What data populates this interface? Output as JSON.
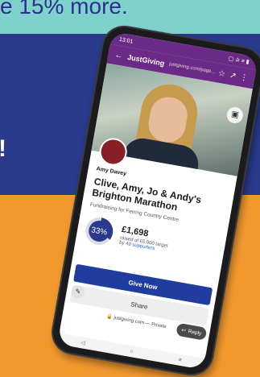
{
  "background": {
    "headline": "e 15% more.",
    "exclamation": "!"
  },
  "status_bar": {
    "time": "13:01",
    "icons": "▢ ✰ ≡ ▮"
  },
  "app_bar": {
    "brand": "JustGiving",
    "url": "justgiving.com/page..."
  },
  "page": {
    "owner_name": "Amy Davey",
    "title": "Clive, Amy, Jo & Andy's Brighton Marathon",
    "fundraising_for": "Fundraising for Ferring Country Centre",
    "progress_percent": "33%",
    "progress_fraction": 0.33,
    "amount_raised": "£1,698",
    "target_text": "raised of £5,000 target",
    "supporters_prefix": "by ",
    "supporters_link": "49 supporters",
    "give_button": "Give Now",
    "share_button": "Share"
  },
  "footer": {
    "url": "🔒 justgiving.com — Private",
    "reply_label": "Reply",
    "nav_back": "◁",
    "nav_home": "○",
    "nav_menu": "≡"
  },
  "colors": {
    "teal_band": "#7fd1cb",
    "blue_band": "#2a3a8c",
    "orange_band": "#f2992e",
    "justgiving_purple": "#6b2a86",
    "give_button": "#1f3d9e"
  }
}
